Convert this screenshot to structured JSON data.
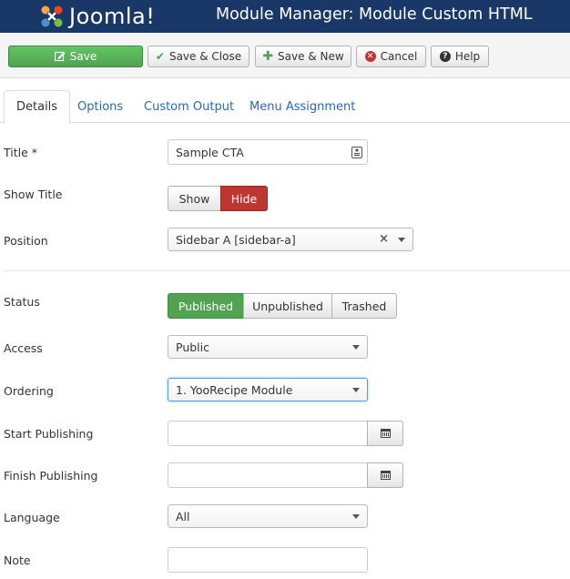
{
  "header": {
    "logo_text": "Joomla!",
    "title": "Module Manager: Module Custom HTML"
  },
  "toolbar": {
    "save_label": "Save",
    "save_close_label": "Save & Close",
    "save_new_label": "Save & New",
    "cancel_label": "Cancel",
    "help_label": "Help"
  },
  "tabs": [
    {
      "label": "Details",
      "active": true
    },
    {
      "label": "Options",
      "active": false
    },
    {
      "label": "Custom Output",
      "active": false
    },
    {
      "label": "Menu Assignment",
      "active": false
    }
  ],
  "form": {
    "title": {
      "label": "Title *",
      "value": "Sample CTA"
    },
    "show_title": {
      "label": "Show Title",
      "options": [
        "Show",
        "Hide"
      ],
      "selected": "Hide"
    },
    "position": {
      "label": "Position",
      "value": "Sidebar A [sidebar-a]"
    },
    "status": {
      "label": "Status",
      "options": [
        "Published",
        "Unpublished",
        "Trashed"
      ],
      "selected": "Published"
    },
    "access": {
      "label": "Access",
      "value": "Public"
    },
    "ordering": {
      "label": "Ordering",
      "value": "1. YooRecipe Module"
    },
    "start_publishing": {
      "label": "Start Publishing",
      "value": ""
    },
    "finish_publishing": {
      "label": "Finish Publishing",
      "value": ""
    },
    "language": {
      "label": "Language",
      "value": "All"
    },
    "note": {
      "label": "Note",
      "value": ""
    }
  },
  "colors": {
    "header_bg": "#1a3867",
    "save_green": "#51a351",
    "hide_red": "#bd362f",
    "link_blue": "#2a69b8"
  }
}
